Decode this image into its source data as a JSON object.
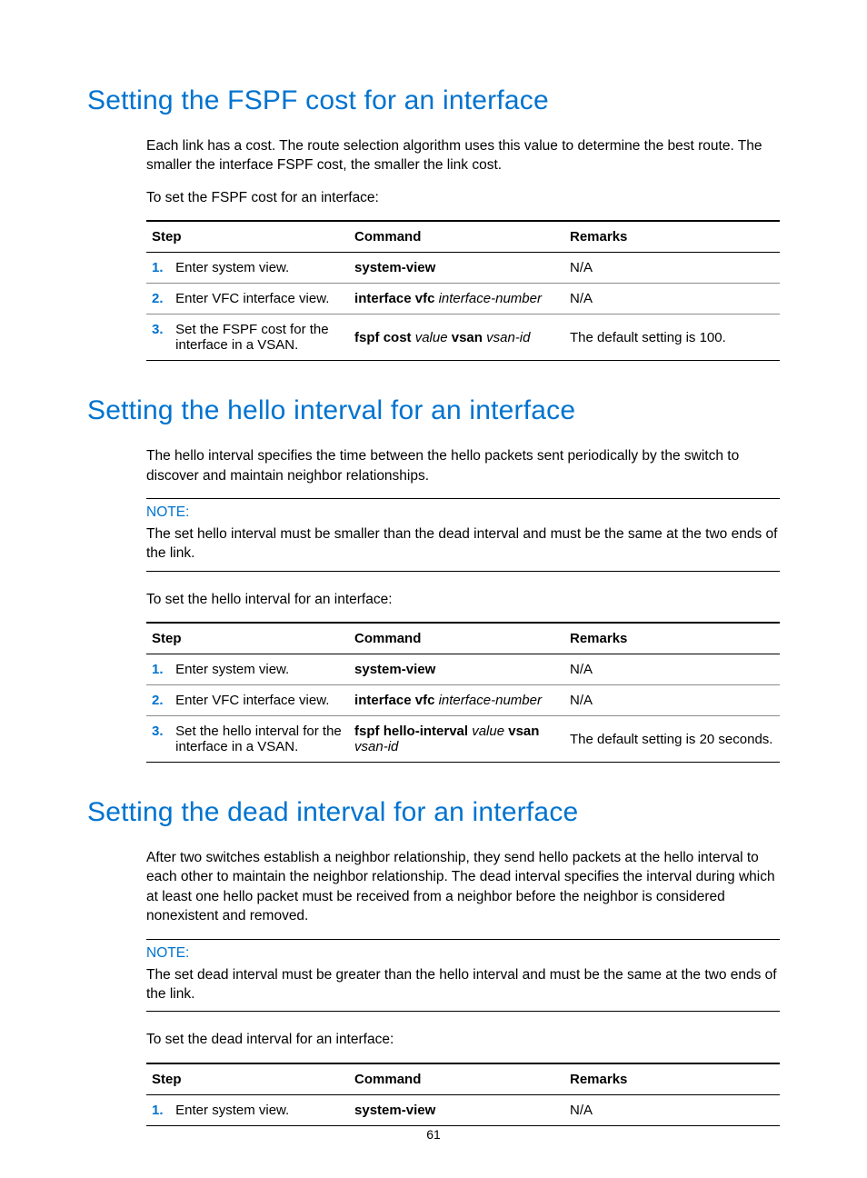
{
  "page_number": "61",
  "sections": [
    {
      "heading": "Setting the FSPF cost for an interface",
      "paras": [
        "Each link has a cost. The route selection algorithm uses this value to determine the best route. The smaller the interface FSPF cost, the smaller the link cost.",
        "To set the FSPF cost for an interface:"
      ],
      "note": null,
      "table": {
        "headers": {
          "step": "Step",
          "command": "Command",
          "remarks": "Remarks"
        },
        "rows": [
          {
            "num": "1.",
            "step": "Enter system view.",
            "cmd": [
              {
                "t": "system-view",
                "b": true
              }
            ],
            "remarks": "N/A"
          },
          {
            "num": "2.",
            "step": "Enter VFC interface view.",
            "cmd": [
              {
                "t": "interface vfc ",
                "b": true
              },
              {
                "t": "interface-number",
                "i": true
              }
            ],
            "remarks": "N/A"
          },
          {
            "num": "3.",
            "step": "Set the FSPF cost for the interface in a VSAN.",
            "cmd": [
              {
                "t": "fspf cost ",
                "b": true
              },
              {
                "t": "value ",
                "i": true
              },
              {
                "t": "vsan ",
                "b": true
              },
              {
                "t": "vsan-id",
                "i": true
              }
            ],
            "remarks": "The default setting is 100."
          }
        ]
      }
    },
    {
      "heading": "Setting the hello interval for an interface",
      "paras": [
        "The hello interval specifies the time between the hello packets sent periodically by the switch to discover and maintain neighbor relationships."
      ],
      "note": {
        "label": "NOTE:",
        "text": "The set hello interval must be smaller than the dead interval and must be the same at the two ends of the link."
      },
      "post_note_paras": [
        "To set the hello interval for an interface:"
      ],
      "table": {
        "headers": {
          "step": "Step",
          "command": "Command",
          "remarks": "Remarks"
        },
        "rows": [
          {
            "num": "1.",
            "step": "Enter system view.",
            "cmd": [
              {
                "t": "system-view",
                "b": true
              }
            ],
            "remarks": "N/A"
          },
          {
            "num": "2.",
            "step": "Enter VFC interface view.",
            "cmd": [
              {
                "t": "interface vfc ",
                "b": true
              },
              {
                "t": "interface-number",
                "i": true
              }
            ],
            "remarks": "N/A"
          },
          {
            "num": "3.",
            "step": "Set the hello interval for the interface in a VSAN.",
            "cmd": [
              {
                "t": "fspf hello-interval ",
                "b": true
              },
              {
                "t": "value ",
                "i": true
              },
              {
                "t": "vsan ",
                "b": true
              },
              {
                "t": "vsan-id",
                "i": true
              }
            ],
            "remarks": "The default setting is 20 seconds."
          }
        ]
      }
    },
    {
      "heading": "Setting the dead interval for an interface",
      "paras": [
        "After two switches establish a neighbor relationship, they send hello packets at the hello interval to each other to maintain the neighbor relationship. The dead interval specifies the interval during which at least one hello packet must be received from a neighbor before the neighbor is considered nonexistent and removed."
      ],
      "note": {
        "label": "NOTE:",
        "text": "The set dead interval must be greater than the hello interval and must be the same at the two ends of the link."
      },
      "post_note_paras": [
        "To set the dead interval for an interface:"
      ],
      "table": {
        "headers": {
          "step": "Step",
          "command": "Command",
          "remarks": "Remarks"
        },
        "rows": [
          {
            "num": "1.",
            "step": "Enter system view.",
            "cmd": [
              {
                "t": "system-view",
                "b": true
              }
            ],
            "remarks": "N/A"
          }
        ]
      }
    }
  ]
}
